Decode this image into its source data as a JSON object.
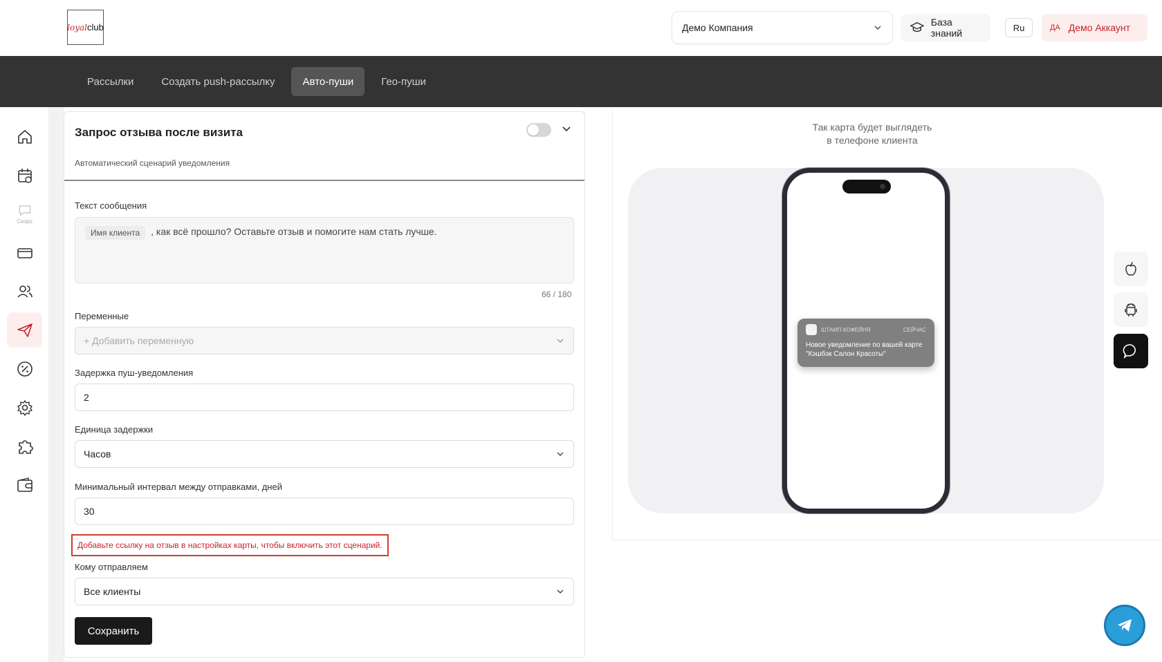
{
  "header": {
    "logo": {
      "part1": "loyal",
      "part2": "club"
    },
    "company_select": {
      "value": "Демо Компания"
    },
    "knowledge_base_label": "База знаний",
    "language": "Ru",
    "account": {
      "initials": "ДА",
      "name": "Демо Аккаунт"
    }
  },
  "topnav": {
    "tabs": [
      {
        "label": "Рассылки",
        "active": false
      },
      {
        "label": "Создать push-рассылку",
        "active": false
      },
      {
        "label": "Авто-пуши",
        "active": true
      },
      {
        "label": "Гео-пуши",
        "active": false
      }
    ]
  },
  "sidebar": {
    "items": [
      {
        "icon": "home-icon"
      },
      {
        "icon": "calendar-icon"
      },
      {
        "icon": "chat-icon",
        "note": "Скоро"
      },
      {
        "icon": "card-icon"
      },
      {
        "icon": "users-icon"
      },
      {
        "icon": "send-icon",
        "active": true
      },
      {
        "icon": "percent-icon"
      },
      {
        "icon": "gear-icon"
      },
      {
        "icon": "puzzle-icon"
      },
      {
        "icon": "wallet-icon"
      }
    ]
  },
  "form": {
    "title": "Запрос отзыва после визита",
    "subtitle": "Автоматический сценарий уведомления",
    "enabled": false,
    "message": {
      "label": "Текст сообщения",
      "chip": "Имя клиента",
      "text": ", как всё прошло? Оставьте отзыв и помогите нам стать лучше.",
      "counter": "66 / 180"
    },
    "variables": {
      "label": "Переменные",
      "placeholder": "+ Добавить переменную"
    },
    "delay": {
      "label": "Задержка пуш-уведомления",
      "value": "2"
    },
    "delay_unit": {
      "label": "Единица задержки",
      "value": "Часов"
    },
    "min_interval": {
      "label": "Минимальный интервал между отправками, дней",
      "value": "30"
    },
    "warning": "Добавьте ссылку на отзыв в настройках карты, чтобы включить этот сценарий.",
    "recipients": {
      "label": "Кому отправляем",
      "value": "Все клиенты"
    },
    "save_label": "Сохранить"
  },
  "preview": {
    "caption_line1": "Так карта будет выглядеть",
    "caption_line2": "в телефоне клиента",
    "notification": {
      "app": "ШТАМП КОФЕЙНЯ",
      "time": "СЕЙЧАС",
      "text": "Новое уведомление по вашей карте \"Кэшбэк Салон Красоты\""
    },
    "platforms": [
      {
        "icon": "apple-icon",
        "active": false
      },
      {
        "icon": "android-icon",
        "active": false
      },
      {
        "icon": "message-icon",
        "active": true
      }
    ]
  },
  "colors": {
    "accent": "#c8232c",
    "nav_bg": "#333333",
    "warning_border": "#d33b2f",
    "telegram": "#2a9ed8"
  }
}
